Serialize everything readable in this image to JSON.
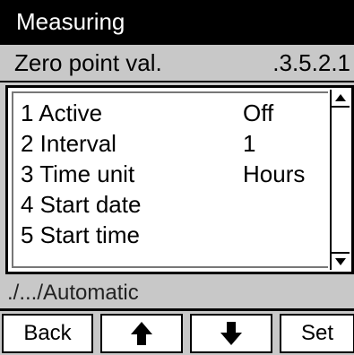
{
  "header": {
    "title": "Measuring"
  },
  "subheader": {
    "label": "Zero point val.",
    "value": ".3.5.2.1"
  },
  "menu": {
    "items": [
      {
        "label": "1 Active",
        "value": "Off"
      },
      {
        "label": "2 Interval",
        "value": "1"
      },
      {
        "label": "3 Time unit",
        "value": "Hours"
      },
      {
        "label": "4 Start date",
        "value": ""
      },
      {
        "label": "5 Start time",
        "value": ""
      }
    ]
  },
  "path": {
    "text": "./.../Automatic"
  },
  "buttons": {
    "back_label": "Back",
    "up_icon": "arrow-up-icon",
    "down_icon": "arrow-down-icon",
    "set_label": "Set"
  }
}
